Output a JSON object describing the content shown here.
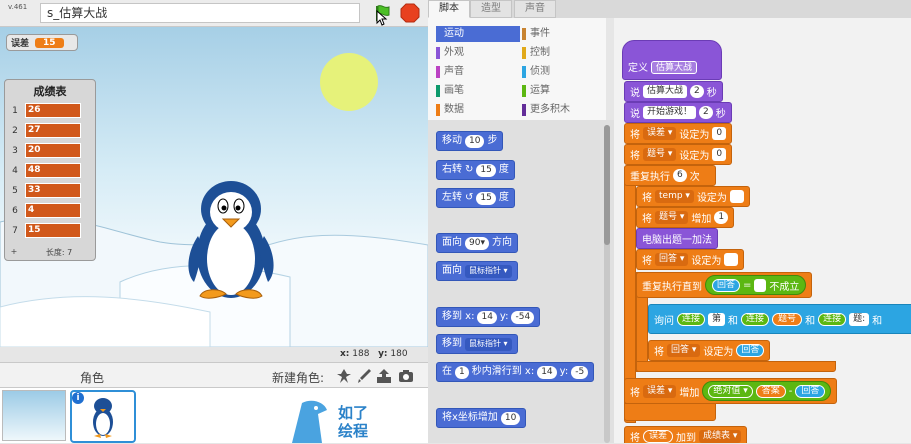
{
  "header": {
    "version": "v.461",
    "project_title": "s_估算大战"
  },
  "stage": {
    "var_monitor": {
      "label": "误差",
      "value": "15"
    },
    "list_monitor": {
      "title": "成绩表",
      "items": [
        {
          "index": "1",
          "value": "26"
        },
        {
          "index": "2",
          "value": "27"
        },
        {
          "index": "3",
          "value": "20"
        },
        {
          "index": "4",
          "value": "48"
        },
        {
          "index": "5",
          "value": "33"
        },
        {
          "index": "6",
          "value": "4"
        },
        {
          "index": "7",
          "value": "15"
        }
      ],
      "plus": "+",
      "length_label": "长度: 7"
    },
    "coords": {
      "x_label": "x:",
      "x_value": "188",
      "y_label": "y:",
      "y_value": "180"
    }
  },
  "sprites": {
    "label": "角色",
    "new_sprite_label": "新建角色:",
    "info": "i",
    "logo_text": [
      "如了",
      "绘程"
    ]
  },
  "tabs": [
    "脚本",
    "造型",
    "声音"
  ],
  "categories": [
    {
      "label": "运动",
      "color": "#4a6cd4",
      "active": true
    },
    {
      "label": "事件",
      "color": "#c88330"
    },
    {
      "label": "外观",
      "color": "#8a55d7"
    },
    {
      "label": "控制",
      "color": "#e1a91a"
    },
    {
      "label": "声音",
      "color": "#bb42c3"
    },
    {
      "label": "侦测",
      "color": "#2ca5e2"
    },
    {
      "label": "画笔",
      "color": "#0e9a6c"
    },
    {
      "label": "运算",
      "color": "#5cb712"
    },
    {
      "label": "数据",
      "color": "#ee7d16"
    },
    {
      "label": "更多积木",
      "color": "#632d99"
    }
  ],
  "palette": {
    "move": {
      "label": "移动",
      "value": "10",
      "suffix": "步"
    },
    "turn_right": {
      "label": "右转",
      "value": "15",
      "suffix": "度"
    },
    "turn_left": {
      "label": "左转",
      "value": "15",
      "suffix": "度"
    },
    "point_dir": {
      "label": "面向",
      "value": "90▾",
      "suffix": "方向"
    },
    "point_towards": {
      "label": "面向",
      "value": "鼠标指针 ▾"
    },
    "goto_xy": {
      "label": "移到 x:",
      "x": "14",
      "y_label": "y:",
      "y": "-54"
    },
    "goto": {
      "label": "移到",
      "value": "鼠标指针 ▾"
    },
    "glide": {
      "label": "在",
      "value": "1",
      "mid": "秒内滑行到 x:",
      "x": "14",
      "y_label": "y:",
      "y": "-5"
    },
    "change_x": {
      "label": "将x坐标增加",
      "value": "10"
    }
  },
  "script": {
    "define": {
      "label": "定义",
      "name": "估算大战"
    },
    "say1": {
      "label": "说",
      "text": "估算大战",
      "secs": "2",
      "suffix": "秒"
    },
    "say2": {
      "label": "说",
      "text": "开始游戏！",
      "secs": "2",
      "suffix": "秒"
    },
    "set_err": {
      "label": "将",
      "var": "误差 ▾",
      "mid": "设定为",
      "value": "0"
    },
    "set_num": {
      "label": "将",
      "var": "题号 ▾",
      "mid": "设定为",
      "value": "0"
    },
    "repeat": {
      "label": "重复执行",
      "value": "6",
      "suffix": "次"
    },
    "set_temp": {
      "label": "将",
      "var": "temp ▾",
      "mid": "设定为",
      "value": ""
    },
    "change_num": {
      "label": "将",
      "var": "题号 ▾",
      "mid": "增加",
      "value": "1"
    },
    "call": {
      "label": "电脑出题一加法"
    },
    "set_ans": {
      "label": "将",
      "var": "回答 ▾",
      "mid": "设定为",
      "value": ""
    },
    "repeat_until": {
      "label": "重复执行直到",
      "reporter": "回答",
      "eq": "=",
      "value": "",
      "suffix": "不成立"
    },
    "ask": {
      "label": "询问",
      "j1": "连接",
      "t1": "第",
      "and1": "和",
      "j2": "连接",
      "r1": "题号",
      "and2": "和",
      "j3": "连接",
      "t2": "题:",
      "and3": "和"
    },
    "set_answer": {
      "label": "将",
      "var": "回答 ▾",
      "mid": "设定为",
      "reporter": "回答"
    },
    "change_err": {
      "label": "将",
      "var": "误差 ▾",
      "mid": "增加",
      "abs": "绝对值 ▾",
      "r1": "答案",
      "minus": "-",
      "r2": "回答"
    },
    "add_list": {
      "label": "将",
      "var": "误差",
      "mid": "加到",
      "list": "成绩表 ▾"
    }
  }
}
